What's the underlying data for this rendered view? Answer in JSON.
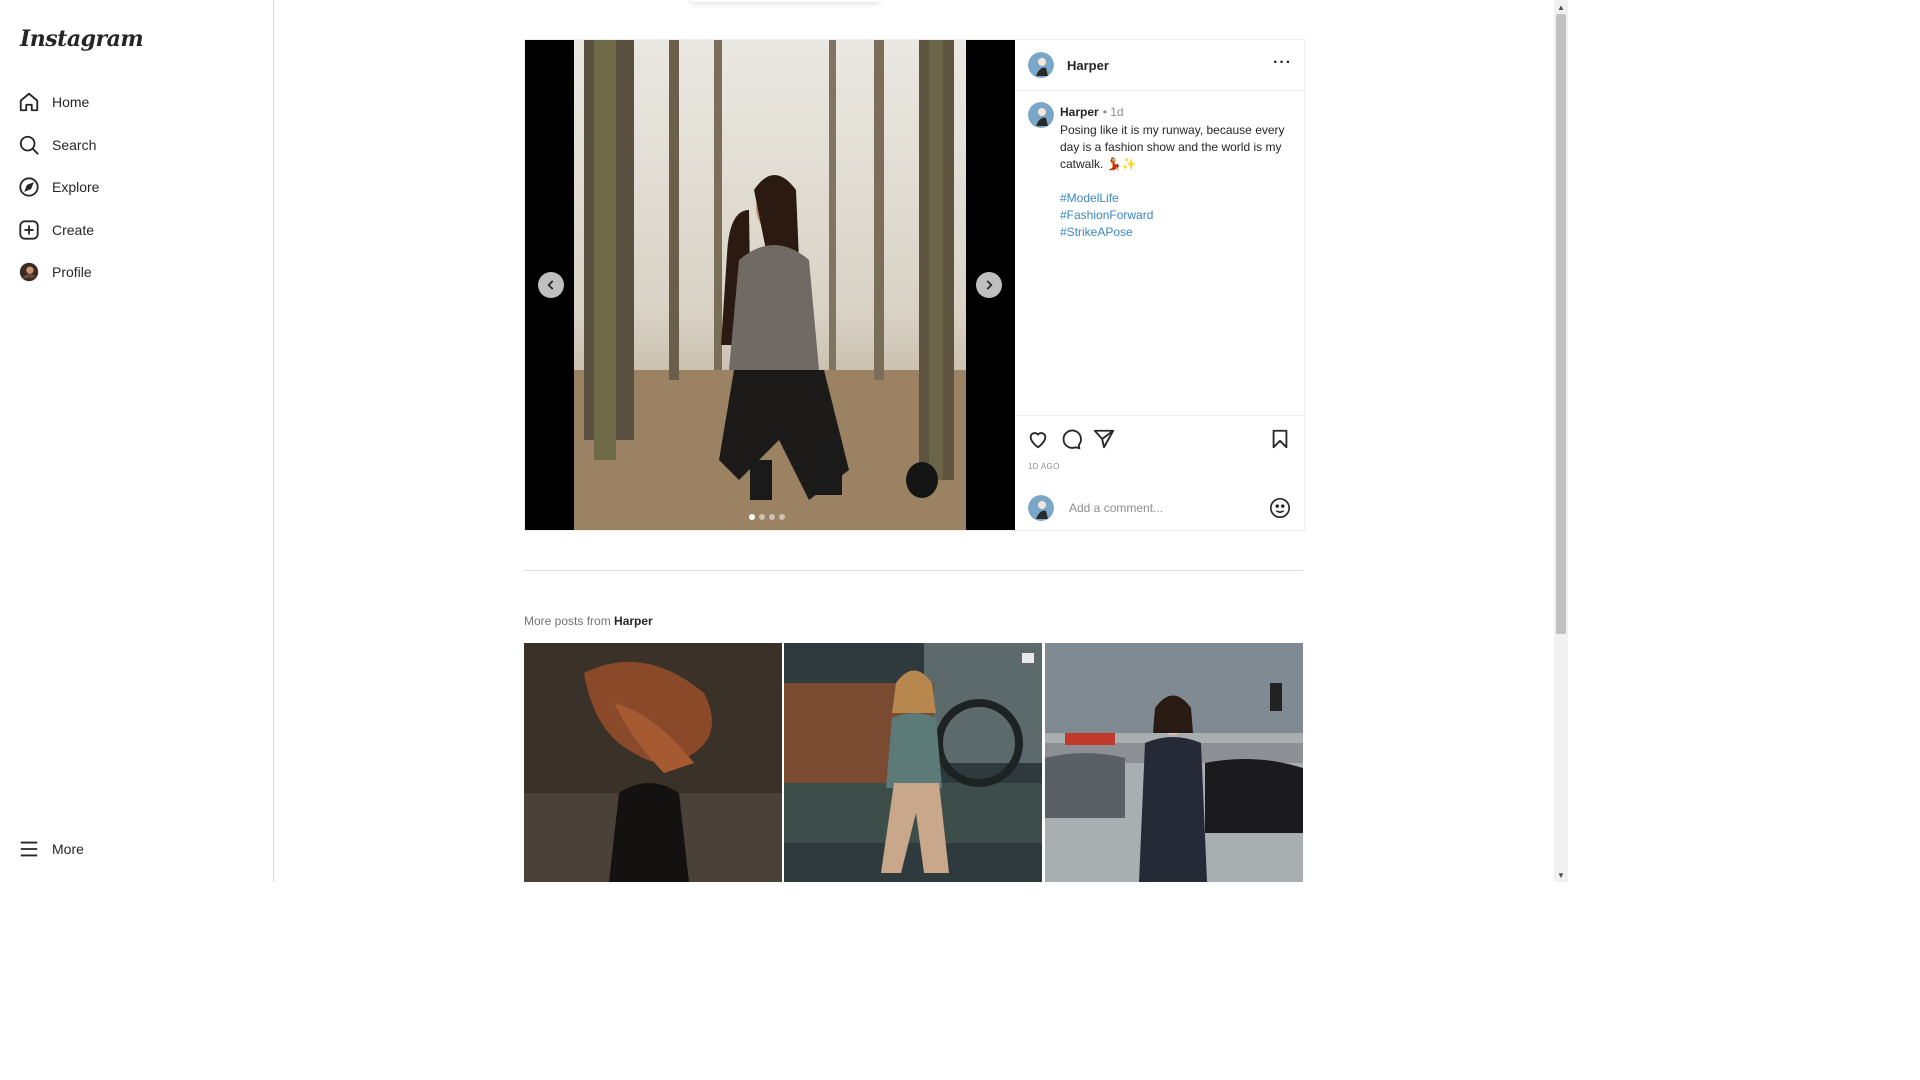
{
  "app": {
    "logo_text": "Instagram"
  },
  "sidebar": {
    "items": [
      {
        "label": "Home",
        "icon": "home-icon"
      },
      {
        "label": "Search",
        "icon": "search-icon"
      },
      {
        "label": "Explore",
        "icon": "compass-icon"
      },
      {
        "label": "Create",
        "icon": "plus-square-icon"
      },
      {
        "label": "Profile",
        "icon": "avatar"
      }
    ],
    "more_label": "More"
  },
  "post": {
    "username": "Harper",
    "time": "• 1d",
    "caption_text": "Posing like it is my runway, because every day is a fashion show and the world is my catwalk. 💃✨",
    "hashtags": [
      "#ModelLife",
      "#FashionForward",
      "#StrikeAPose"
    ],
    "ago_label": "1D AGO",
    "comment_placeholder": "Add a comment...",
    "carousel": {
      "count": 4,
      "active_index": 0
    }
  },
  "more_posts": {
    "prefix": "More posts from",
    "username": "Harper"
  }
}
